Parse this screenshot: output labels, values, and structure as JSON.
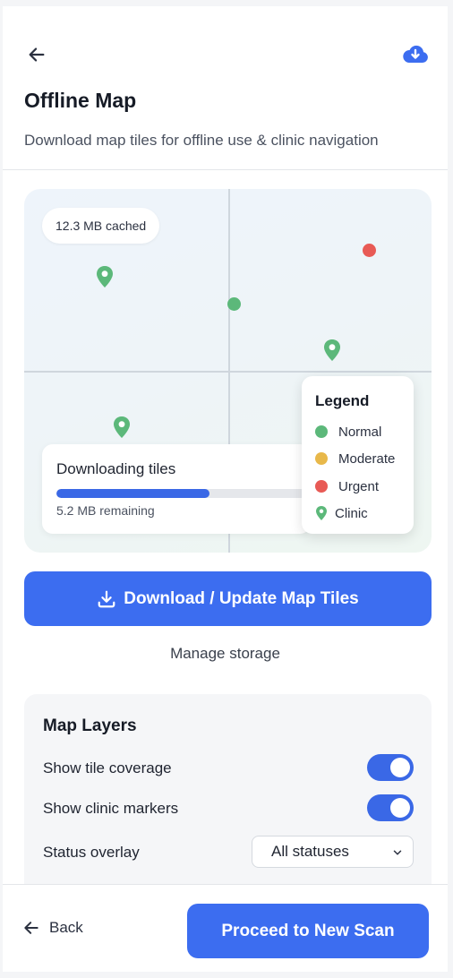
{
  "header": {
    "back_icon": "arrow-left-icon",
    "download_icon": "cloud-download-icon",
    "title": "Offline Map",
    "subtitle": "Download map tiles for offline use & clinic navigation"
  },
  "map": {
    "cache_label": "12.3 MB cached",
    "download": {
      "title": "Downloading tiles",
      "progress": 0.59,
      "remaining_label": "5.2 MB remaining"
    },
    "legend": {
      "title": "Legend",
      "items": [
        {
          "label": "Normal",
          "color": "#5cb87a",
          "shape": "dot"
        },
        {
          "label": "Moderate",
          "color": "#e8b84a",
          "shape": "dot"
        },
        {
          "label": "Urgent",
          "color": "#e85a55",
          "shape": "dot"
        },
        {
          "label": "Clinic",
          "color": "#5cb87a",
          "shape": "pin"
        }
      ]
    }
  },
  "actions": {
    "download_button": "Download / Update Map Tiles",
    "manage_link": "Manage storage"
  },
  "layers": {
    "title": "Map Layers",
    "tile_coverage": {
      "label": "Show tile coverage",
      "on": true
    },
    "clinic_markers": {
      "label": "Show clinic markers",
      "on": true
    },
    "status_overlay": {
      "label": "Status overlay",
      "value": "All statuses"
    }
  },
  "footer": {
    "back_label": "Back",
    "proceed_label": "Proceed to New Scan"
  },
  "colors": {
    "accent": "#3c6df0",
    "normal": "#5cb87a",
    "moderate": "#e8b84a",
    "urgent": "#e85a55"
  }
}
